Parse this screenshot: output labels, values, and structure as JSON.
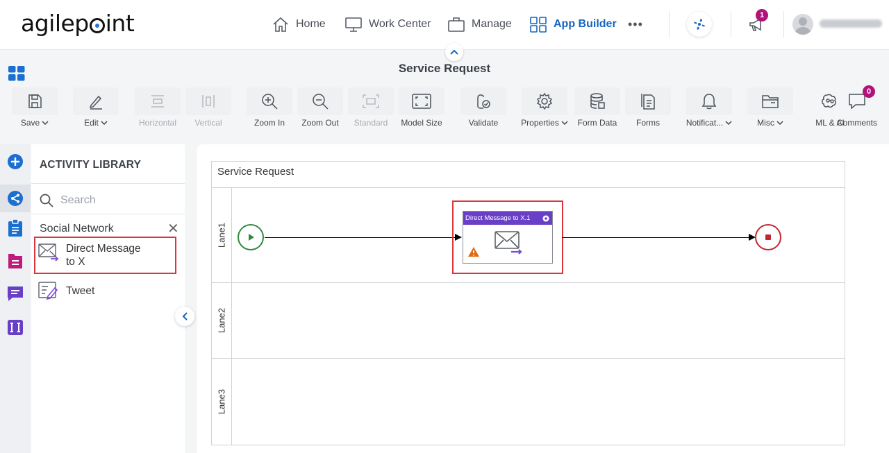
{
  "brand": {
    "logo_text_a": "agilep",
    "logo_text_b": "int"
  },
  "topnav": {
    "items": [
      {
        "label": "Home",
        "icon": "home-icon"
      },
      {
        "label": "Work Center",
        "icon": "monitor-icon"
      },
      {
        "label": "Manage",
        "icon": "briefcase-icon"
      },
      {
        "label": "App Builder",
        "icon": "grid-icon",
        "active": true
      },
      {
        "label": "•••",
        "icon": "more-icon"
      }
    ],
    "notification_count": "1",
    "user_name": "(blurred)"
  },
  "titlebar": {
    "title": "Service Request"
  },
  "toolbar": {
    "buttons": [
      {
        "label": "Save",
        "icon": "save-icon",
        "dropdown": true
      },
      {
        "label": "Edit",
        "icon": "edit-icon",
        "dropdown": true
      },
      {
        "label": "Horizontal",
        "icon": "horizontal-icon",
        "disabled": true
      },
      {
        "label": "Vertical",
        "icon": "vertical-icon",
        "disabled": true
      },
      {
        "label": "Zoom In",
        "icon": "zoom-in-icon"
      },
      {
        "label": "Zoom Out",
        "icon": "zoom-out-icon"
      },
      {
        "label": "Standard",
        "icon": "standard-icon",
        "disabled": true
      },
      {
        "label": "Model Size",
        "icon": "model-size-icon"
      },
      {
        "label": "Validate",
        "icon": "validate-icon"
      },
      {
        "label": "Properties",
        "icon": "gear-icon",
        "dropdown": true
      },
      {
        "label": "Form Data",
        "icon": "database-icon"
      },
      {
        "label": "Forms",
        "icon": "forms-icon"
      },
      {
        "label": "Notificat...",
        "icon": "bell-icon",
        "dropdown": true
      },
      {
        "label": "Misc",
        "icon": "folder-icon",
        "dropdown": true
      },
      {
        "label": "ML & AI",
        "icon": "brain-icon"
      },
      {
        "label": "Comments",
        "icon": "comment-icon"
      }
    ],
    "comments_count": "0"
  },
  "library": {
    "title": "ACTIVITY LIBRARY",
    "search_placeholder": "Search",
    "category": "Social Network",
    "items": [
      {
        "label": "Direct Message to X",
        "icon": "direct-message-icon",
        "selected": true
      },
      {
        "label": "Tweet",
        "icon": "tweet-icon"
      }
    ]
  },
  "canvas": {
    "pool_title": "Service Request",
    "lanes": [
      "Lane1",
      "Lane2",
      "Lane3"
    ],
    "task": {
      "title": "Direct Message to X.1",
      "has_warning": true
    }
  },
  "colors": {
    "accent": "#1565c0",
    "task_header": "#6a3fc8",
    "highlight": "#d9363e",
    "start": "#2e8b3d",
    "end": "#c1272d"
  }
}
